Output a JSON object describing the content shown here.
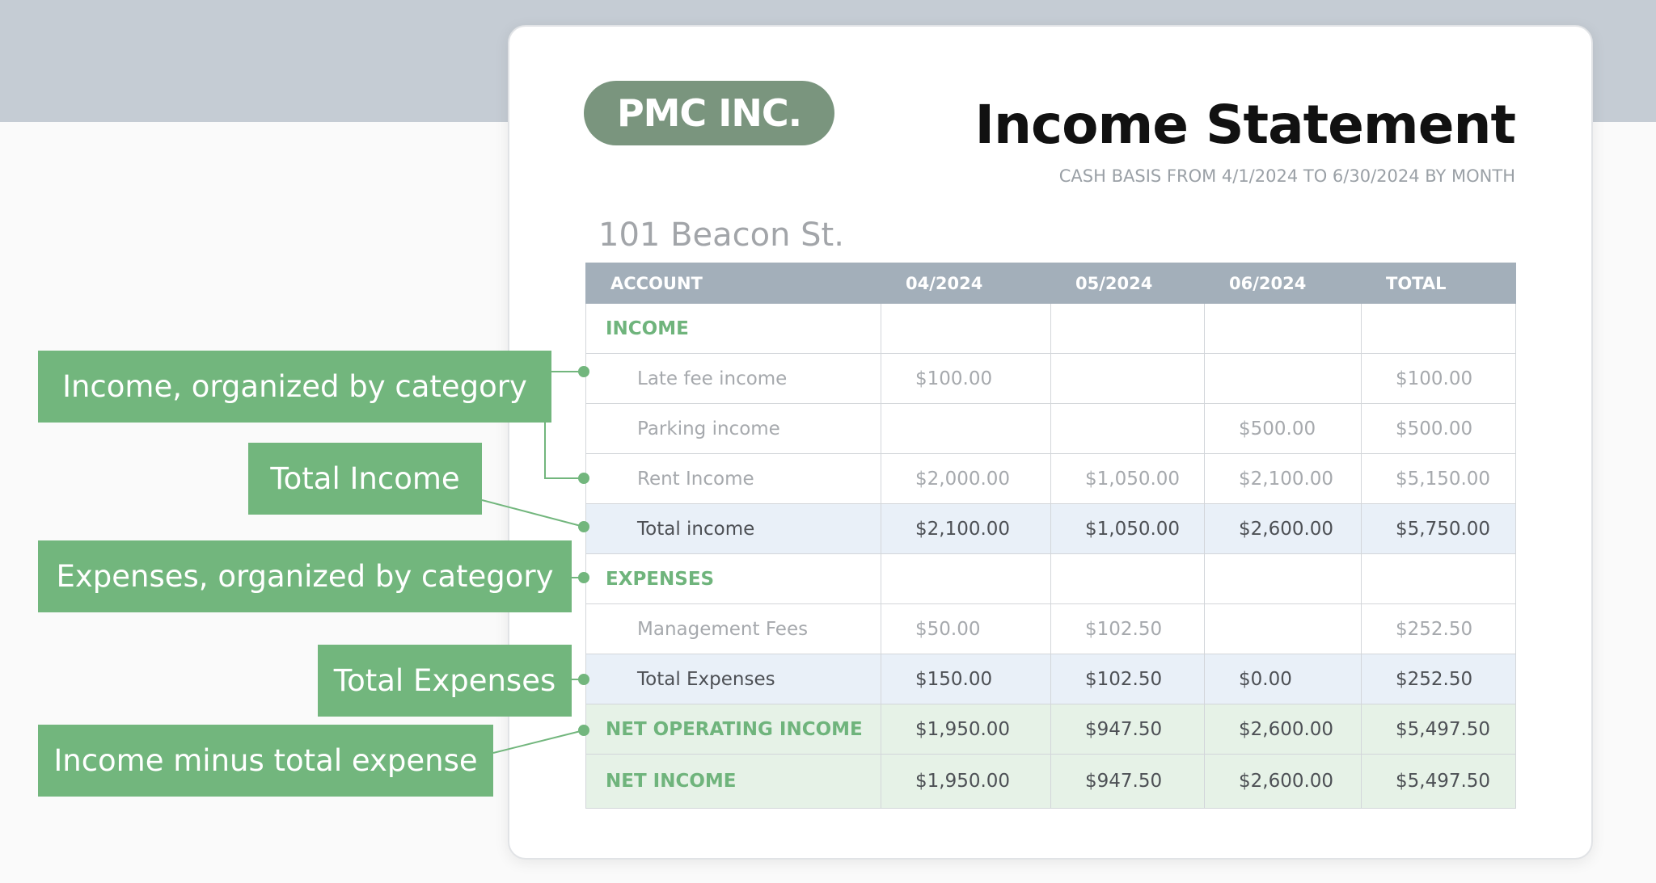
{
  "document": {
    "logo": "PMC INC.",
    "title": "Income Statement",
    "subtitle": "CASH BASIS FROM 4/1/2024 TO 6/30/2024 BY MONTH",
    "property": "101 Beacon St."
  },
  "table": {
    "headers": [
      "ACCOUNT",
      "04/2024",
      "05/2024",
      "06/2024",
      "TOTAL"
    ],
    "rows": [
      {
        "account": "INCOME",
        "m1": "",
        "m2": "",
        "m3": "",
        "total": ""
      },
      {
        "account": "Late fee income",
        "m1": "$100.00",
        "m2": "",
        "m3": "",
        "total": "$100.00"
      },
      {
        "account": "Parking income",
        "m1": "",
        "m2": "",
        "m3": "$500.00",
        "total": "$500.00"
      },
      {
        "account": "Rent Income",
        "m1": "$2,000.00",
        "m2": "$1,050.00",
        "m3": "$2,100.00",
        "total": "$5,150.00"
      },
      {
        "account": "Total income",
        "m1": "$2,100.00",
        "m2": "$1,050.00",
        "m3": "$2,600.00",
        "total": "$5,750.00"
      },
      {
        "account": "EXPENSES",
        "m1": "",
        "m2": "",
        "m3": "",
        "total": ""
      },
      {
        "account": "Management Fees",
        "m1": "$50.00",
        "m2": "$102.50",
        "m3": "",
        "total": "$252.50"
      },
      {
        "account": "Total Expenses",
        "m1": "$150.00",
        "m2": "$102.50",
        "m3": "$0.00",
        "total": "$252.50"
      },
      {
        "account": "NET OPERATING INCOME",
        "m1": "$1,950.00",
        "m2": "$947.50",
        "m3": "$2,600.00",
        "total": "$5,497.50"
      },
      {
        "account": "NET INCOME",
        "m1": "$1,950.00",
        "m2": "$947.50",
        "m3": "$2,600.00",
        "total": "$5,497.50"
      }
    ]
  },
  "callouts": {
    "income_category": "Income, organized by category",
    "total_income": "Total Income",
    "expenses_category": "Expenses, organized by category",
    "total_expenses": "Total Expenses",
    "income_minus": "Income minus total expense"
  },
  "colors": {
    "accent_green": "#72b67d",
    "header_gray": "#a3afba",
    "logo_green": "#7a957e",
    "total_row_blue": "#e9f0f8",
    "net_row_green": "#e6f2e7"
  }
}
